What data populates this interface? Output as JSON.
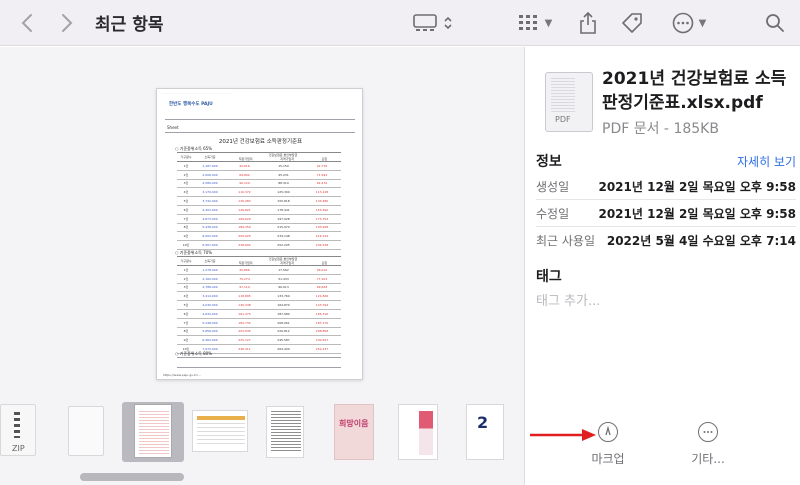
{
  "toolbar": {
    "title": "최근 항목",
    "back_icon": "chevron-left-icon",
    "forward_icon": "chevron-right-icon",
    "colors": {
      "bg": "#f1eff4",
      "icon": "#77767c"
    }
  },
  "preview": {
    "document": {
      "org_name": "한반도 행복수도 PAJU",
      "sheet_label": "Sheet",
      "table_title": "2021년 건강보험료 소득판정기준표",
      "section_1": "○ 기준중위소득 65%",
      "section_2": "○ 기준중위소득 70%",
      "section_3": "○ 기준중위소득 80%",
      "col_household": "가구원수",
      "col_income": "소득기준",
      "col_group": "건강보험료 본인부담금",
      "col_employee": "직장가입자",
      "col_regional": "지역가입자",
      "col_mixed": "혼합",
      "rows_65": [
        {
          "n": "1인",
          "inc": "1,187,000",
          "e": "42,616",
          "r": "15,150",
          "m": "42,776"
        },
        {
          "n": "2인",
          "inc": "2,006,000",
          "e": "69,892",
          "r": "45,031",
          "m": "71,592"
        },
        {
          "n": "3인",
          "inc": "2,589,000",
          "e": "90,129",
          "r": "88,310",
          "m": "92,476"
        },
        {
          "n": "4인",
          "inc": "3,170,000",
          "e": "110,372",
          "r": "125,300",
          "m": "113,128"
        },
        {
          "n": "5인",
          "inc": "3,742,000",
          "e": "130,283",
          "r": "155,818",
          "m": "133,480"
        },
        {
          "n": "6인",
          "inc": "4,303,000",
          "e": "149,821",
          "r": "178,441",
          "m": "153,490"
        },
        {
          "n": "7인",
          "inc": "4,873,000",
          "e": "169,629",
          "r": "197,928",
          "m": "173,754"
        },
        {
          "n": "8인",
          "inc": "5,438,000",
          "e": "189,359",
          "r": "215,970",
          "m": "193,928"
        },
        {
          "n": "9인",
          "inc": "6,002,000",
          "e": "209,025",
          "r": "234,148",
          "m": "214,124"
        },
        {
          "n": "10인",
          "inc": "6,567,000",
          "e": "228,692",
          "r": "252,205",
          "m": "234,238"
        }
      ],
      "rows_70": [
        {
          "n": "1인",
          "inc": "1,278,000",
          "e": "45,866",
          "r": "17,562",
          "m": "46,010"
        },
        {
          "n": "2인",
          "inc": "2,160,000",
          "e": "75,274",
          "r": "51,433",
          "m": "77,103"
        },
        {
          "n": "3인",
          "inc": "2,788,000",
          "e": "97,110",
          "r": "96,013",
          "m": "99,628"
        },
        {
          "n": "4인",
          "inc": "3,414,000",
          "e": "118,895",
          "r": "133,760",
          "m": "121,846"
        },
        {
          "n": "5인",
          "inc": "4,030,000",
          "e": "140,348",
          "r": "164,870",
          "m": "143,794"
        },
        {
          "n": "6인",
          "inc": "4,634,000",
          "e": "161,375",
          "r": "187,980",
          "m": "165,316"
        },
        {
          "n": "7인",
          "inc": "5,248,000",
          "e": "182,734",
          "r": "208,061",
          "m": "187,170"
        },
        {
          "n": "8인",
          "inc": "5,856,000",
          "e": "203,945",
          "r": "226,812",
          "m": "208,858"
        },
        {
          "n": "9인",
          "inc": "6,464,000",
          "e": "225,127",
          "r": "245,587",
          "m": "230,567"
        },
        {
          "n": "10인",
          "inc": "7,072,000",
          "e": "246,311",
          "r": "264,420",
          "m": "252,237"
        }
      ],
      "footer_url": "https://www.paju.go.kr/..."
    }
  },
  "thumbnails": [
    {
      "kind": "zip",
      "label": "ZIP"
    },
    {
      "kind": "blank",
      "label": ""
    },
    {
      "kind": "spreadsheet-pdf",
      "label": "",
      "selected": true
    },
    {
      "kind": "sheet",
      "label": ""
    },
    {
      "kind": "form",
      "label": ""
    },
    {
      "kind": "poster",
      "label": "희망이음"
    },
    {
      "kind": "flyer",
      "label": ""
    },
    {
      "kind": "leaflet",
      "label": ""
    }
  ],
  "info": {
    "file_name": "2021년 건강보험료 소득판정기준표.xlsx.pdf",
    "file_kind": "PDF 문서 - 185KB",
    "file_icon_label": "PDF",
    "section_info": "정보",
    "more_link": "자세히 보기",
    "rows": [
      {
        "label": "생성일",
        "value": "2021년 12월 2일 목요일 오후 9:58"
      },
      {
        "label": "수정일",
        "value": "2021년 12월 2일 목요일 오후 9:58"
      },
      {
        "label": "최근 사용일",
        "value": "2022년 5월 4일 수요일 오후 7:14"
      }
    ],
    "section_tags": "태그",
    "tags_placeholder": "태그 추가...",
    "action_markup": "마크업",
    "action_more": "기타..."
  },
  "annotation": {
    "arrow_color": "#e02020"
  }
}
